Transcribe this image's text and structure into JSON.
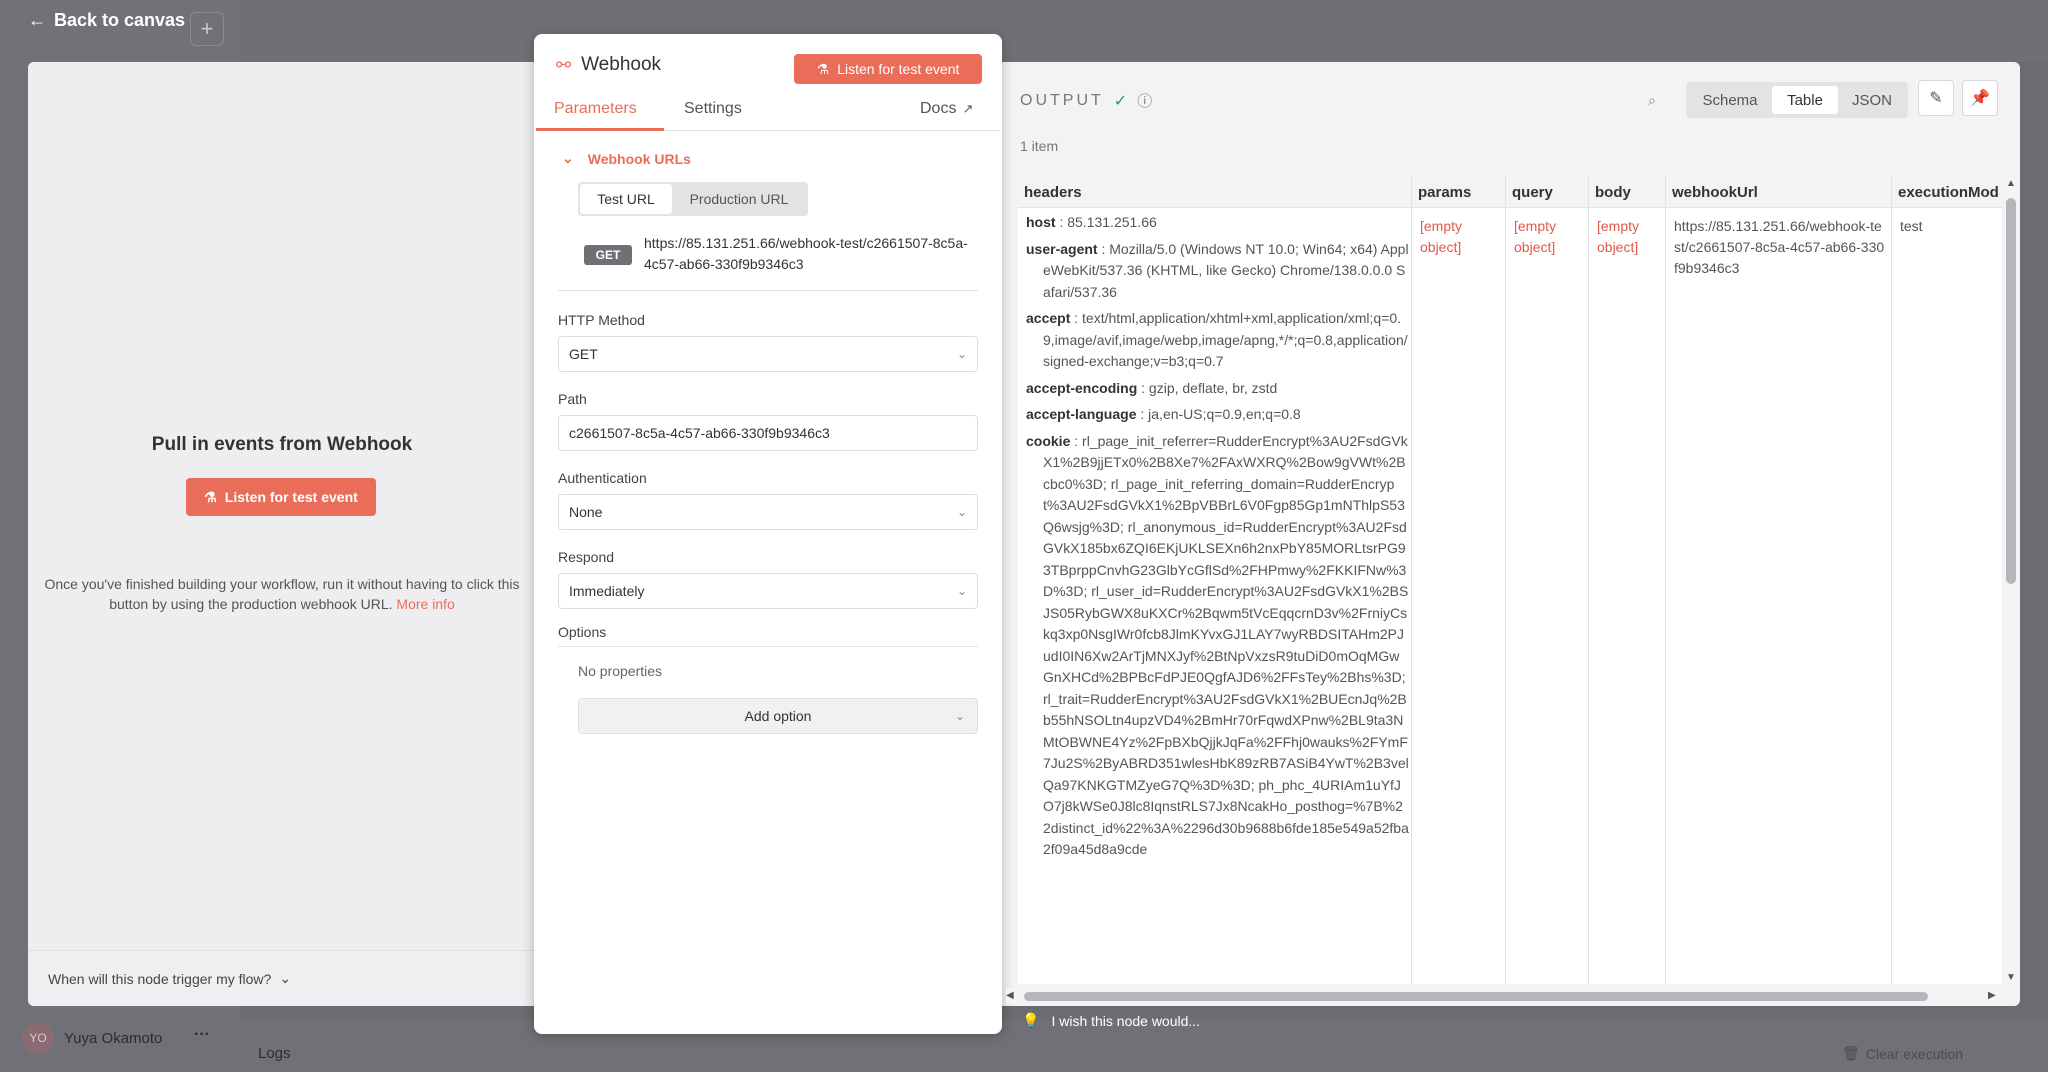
{
  "background": {
    "back_link": "Back to canvas",
    "user_initials": "YO",
    "user_name": "Yuya Okamoto",
    "more": "···",
    "logs": "Logs",
    "clear_execution": "Clear execution",
    "wish": "I wish this node would..."
  },
  "left_pane": {
    "title": "Pull in events from Webhook",
    "listen_button": "Listen for test event",
    "description": "Once you've finished building your workflow, run it without having to click this button by using the production webhook URL.",
    "more_info": "More info",
    "trigger_question": "When will this node trigger my flow?"
  },
  "panel": {
    "title": "Webhook",
    "listen_button": "Listen for test event",
    "tabs": {
      "parameters": "Parameters",
      "settings": "Settings",
      "docs": "Docs"
    },
    "webhook_urls": "Webhook URLs",
    "test_url": "Test URL",
    "production_url": "Production URL",
    "method_badge": "GET",
    "url": "https://85.131.251.66/webhook-test/c2661507-8c5a-4c57-ab66-330f9b9346c3",
    "http_method_label": "HTTP Method",
    "http_method_value": "GET",
    "path_label": "Path",
    "path_value": "c2661507-8c5a-4c57-ab66-330f9b9346c3",
    "auth_label": "Authentication",
    "auth_value": "None",
    "respond_label": "Respond",
    "respond_value": "Immediately",
    "options_label": "Options",
    "no_properties": "No properties",
    "add_option": "Add option"
  },
  "output": {
    "label": "OUTPUT",
    "item_count": "1 item",
    "views": {
      "schema": "Schema",
      "table": "Table",
      "json": "JSON"
    },
    "columns": [
      "headers",
      "params",
      "query",
      "body",
      "webhookUrl",
      "executionMod"
    ],
    "headers": [
      {
        "key": "host",
        "value": "85.131.251.66"
      },
      {
        "key": "user-agent",
        "value": "Mozilla/5.0 (Windows NT 10.0; Win64; x64) AppleWebKit/537.36 (KHTML, like Gecko) Chrome/138.0.0.0 Safari/537.36"
      },
      {
        "key": "accept",
        "value": "text/html,application/xhtml+xml,application/xml;q=0.9,image/avif,image/webp,image/apng,*/*;q=0.8,application/signed-exchange;v=b3;q=0.7"
      },
      {
        "key": "accept-encoding",
        "value": "gzip, deflate, br, zstd"
      },
      {
        "key": "accept-language",
        "value": "ja,en-US;q=0.9,en;q=0.8"
      },
      {
        "key": "cookie",
        "value": "rl_page_init_referrer=RudderEncrypt%3AU2FsdGVkX1%2B9jjETx0%2B8Xe7%2FAxWXRQ%2Bow9gVWt%2Bcbc0%3D; rl_page_init_referring_domain=RudderEncrypt%3AU2FsdGVkX1%2BpVBBrL6V0Fgp85Gp1mNThlpS53Q6wsjg%3D; rl_anonymous_id=RudderEncrypt%3AU2FsdGVkX185bx6ZQI6EKjUKLSEXn6h2nxPbY85MORLtsrPG93TBprppCnvhG23GlbYcGflSd%2FHPmwy%2FKKIFNw%3D%3D; rl_user_id=RudderEncrypt%3AU2FsdGVkX1%2BSJS05RybGWX8uKXCr%2Bqwm5tVcEqqcrnD3v%2FrniyCskq3xp0NsgIWr0fcb8JlmKYvxGJ1LAY7wyRBDSITAHm2PJudI0IN6Xw2ArTjMNXJyf%2BtNpVxzsR9tuDiD0mOqMGwGnXHCd%2BPBcFdPJE0QgfAJD6%2FFsTey%2Bhs%3D; rl_trait=RudderEncrypt%3AU2FsdGVkX1%2BUEcnJq%2Bb55hNSOLtn4upzVD4%2BmHr70rFqwdXPnw%2BL9ta3NMtOBWNE4Yz%2FpBXbQjjkJqFa%2FFhj0wauks%2FYmF7Ju2S%2ByABRD351wlesHbK89zRB7ASiB4YwT%2B3velQa97KNKGTMZyeG7Q%3D%3D; ph_phc_4URIAm1uYfJO7j8kWSe0J8lc8IqnstRLS7Jx8NcakHo_posthog=%7B%22distinct_id%22%3A%2296d30b9688b6fde185e549a52fba2f09a45d8a9cde"
      }
    ],
    "params": "[empty object]",
    "query": "[empty object]",
    "body": "[empty object]",
    "webhook_url": "https://85.131.251.66/webhook-test/c2661507-8c5a-4c57-ab66-330f9b9346c3",
    "execution_mode": "test"
  },
  "colors": {
    "accent": "#ea6d5a",
    "success": "#2f9e5b"
  }
}
